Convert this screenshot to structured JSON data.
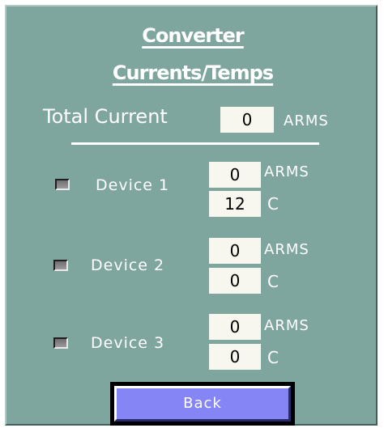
{
  "header": {
    "title_line1": "Converter",
    "title_line2": "Currents/Temps"
  },
  "total": {
    "label": "Total Current",
    "value": "0",
    "unit": "ARMS"
  },
  "devices": [
    {
      "label": "Device 1",
      "current": "0",
      "current_unit": "ARMS",
      "temp": "12",
      "temp_unit": "C"
    },
    {
      "label": "Device 2",
      "current": "0",
      "current_unit": "ARMS",
      "temp": "0",
      "temp_unit": "C"
    },
    {
      "label": "Device 3",
      "current": "0",
      "current_unit": "ARMS",
      "temp": "0",
      "temp_unit": "C"
    }
  ],
  "back_button": {
    "label": "Back"
  },
  "colors": {
    "panel": "#7fa69e",
    "value_box": "#f7f7ef",
    "button": "#8585f5"
  }
}
